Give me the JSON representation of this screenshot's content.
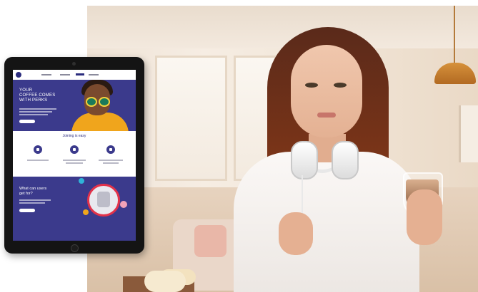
{
  "hero": {
    "title_line1": "YOUR",
    "title_line2": "COFFEE COMES",
    "title_line3": "WITH PERKS"
  },
  "steps": {
    "title": "Joining is easy"
  },
  "perks": {
    "title_line1": "What can users",
    "title_line2": "get for?"
  },
  "colors": {
    "brand_purple": "#3b3a8c",
    "accent_yellow": "#f0a51c",
    "accent_red": "#e3324a"
  }
}
